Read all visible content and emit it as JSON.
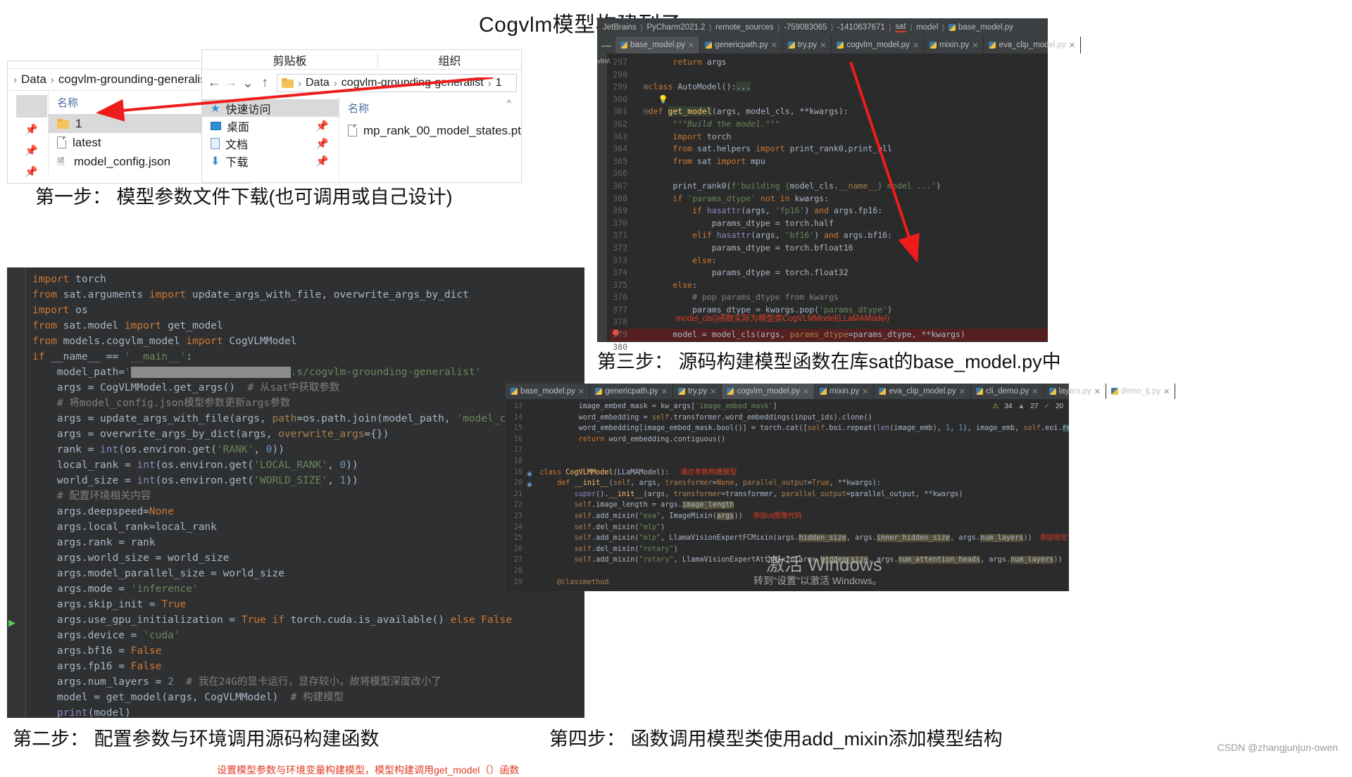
{
  "page": {
    "title": "Cogvlm模型构建列子",
    "credit": "CSDN @zhangjunjun-owen",
    "watermark_main": "激活 Windows",
    "watermark_sub": "转到\"设置\"以激活 Windows。"
  },
  "explorer_back": {
    "breadcrumb": [
      "Data",
      "cogvlm-grounding-generalist"
    ],
    "column_header": "名称",
    "items": [
      {
        "label": "1",
        "icon": "folder-icon",
        "selected": true
      },
      {
        "label": "latest",
        "icon": "file-icon",
        "selected": false
      },
      {
        "label": "model_config.json",
        "icon": "json-file-icon",
        "selected": false
      }
    ]
  },
  "explorer_front": {
    "ribbon_groups": [
      "剪贴板",
      "组织"
    ],
    "nav": {
      "back": "←",
      "forward": "→",
      "recent": "⌄",
      "up": "↑"
    },
    "breadcrumb": [
      "Data",
      "cogvlm-grounding-generalist",
      "1"
    ],
    "quick_access": {
      "title": "快速访问",
      "items": [
        {
          "label": "桌面",
          "icon": "desktop-icon",
          "pinned": true
        },
        {
          "label": "文档",
          "icon": "documents-icon",
          "pinned": true
        },
        {
          "label": "下载",
          "icon": "downloads-icon",
          "pinned": true
        }
      ]
    },
    "column_header": "名称",
    "files": [
      {
        "label": "mp_rank_00_model_states.pt",
        "icon": "file-icon"
      }
    ]
  },
  "steps": {
    "step1": "第一步： 模型参数文件下载(也可调用或自己设计)",
    "step2": "第二步： 配置参数与环境调用源码构建函数",
    "step3": "第三步： 源码构建模型函数在库sat的base_model.py中",
    "step4": "第四步： 函数调用模型类使用add_mixin添加模型结构"
  },
  "code_editor_step2": {
    "annotation": "设置模型参数与环境变量构建模型，模型构建调用get_model（）函数",
    "lines": [
      "import torch",
      "from sat.arguments import update_args_with_file, overwrite_args_by_dict",
      "import os",
      "from sat.model import get_model",
      "from models.cogvlm_model import import CogVLMModel",
      "if __name__ == '__main__':",
      "    model_path='/████/███/██████/██/██████.s/cogvlm-grounding-generalist'",
      "    args = CogVLMModel.get_args()  # 从sat中获取参数",
      "    # 将model_config.json模型参数更新args参数",
      "    args = update_args_with_file(args, path=os.path.join(model_path, 'model_config.json'))",
      "    args = overwrite_args_by_dict(args, overwrite_args={})",
      "    rank = int(os.environ.get('RANK', 0))",
      "    local_rank = int(os.environ.get('LOCAL_RANK', 0))",
      "    world_size = int(os.environ.get('WORLD_SIZE', 1))",
      "    # 配置环境相关内容",
      "    args.deepspeed=None",
      "    args.local_rank=local_rank",
      "    args.rank = rank",
      "    args.world_size = world_size",
      "    args.model_parallel_size = world_size",
      "    args.mode = 'inference'",
      "    args.skip_init = True",
      "    args.use_gpu_initialization = True if torch.cuda.is_available() else False",
      "    args.device = 'cuda'",
      "    args.bf16 = False",
      "    args.fp16 = False",
      "    args.num_layers = 2  # 我在24G的显卡运行，显存较小，故将模型深度改小了",
      "    model = get_model(args, CogVLMModel)  # 构建模型",
      "    print(model)"
    ]
  },
  "pycharm_step3": {
    "breadcrumb": [
      "JetBrains",
      "PyCharm2021.2",
      "remote_sources",
      "-759083065",
      "-1410637671",
      "sat",
      "model",
      "base_model.py"
    ],
    "tabs": [
      {
        "label": "base_model.py",
        "active": true
      },
      {
        "label": "genericpath.py",
        "active": false
      },
      {
        "label": "try.py",
        "active": false
      },
      {
        "label": "cogvlm_model.py",
        "active": false
      },
      {
        "label": "mixin.py",
        "active": false
      },
      {
        "label": "eva_clip_model.py",
        "active": false
      }
    ],
    "annotation": "model_cls()函数实际为模型类CogVLMModel(LLaMAModel)",
    "code": [
      {
        "n": "297",
        "text": "        return args"
      },
      {
        "n": "298",
        "text": ""
      },
      {
        "n": "299",
        "text": "    class AutoModel():..."
      },
      {
        "n": "300",
        "text": "        💡"
      },
      {
        "n": "361",
        "text": "    def get_model(args, model_cls, **kwargs):"
      },
      {
        "n": "362",
        "text": "        \"\"\"Build the model.\"\"\""
      },
      {
        "n": "363",
        "text": "        import torch"
      },
      {
        "n": "364",
        "text": "        from sat.helpers import print_rank0,print_all"
      },
      {
        "n": "365",
        "text": "        from sat import mpu"
      },
      {
        "n": "366",
        "text": ""
      },
      {
        "n": "367",
        "text": "        print_rank0(f'building {model_cls.__name__} model ...')"
      },
      {
        "n": "368",
        "text": "        if 'params_dtype' not in kwargs:"
      },
      {
        "n": "369",
        "text": "            if hasattr(args, 'fp16') and args.fp16:"
      },
      {
        "n": "370",
        "text": "                params_dtype = torch.half"
      },
      {
        "n": "371",
        "text": "            elif hasattr(args, 'bf16') and args.bf16:"
      },
      {
        "n": "372",
        "text": "                params_dtype = torch.bfloat16"
      },
      {
        "n": "373",
        "text": "            else:"
      },
      {
        "n": "374",
        "text": "                params_dtype = torch.float32"
      },
      {
        "n": "375",
        "text": "        else:"
      },
      {
        "n": "376",
        "text": "            # pop params_dtype from kwargs"
      },
      {
        "n": "377",
        "text": "            params_dtype = kwargs.pop('params_dtype')"
      },
      {
        "n": "378",
        "text": ""
      },
      {
        "n": "379",
        "text": "        model = model_cls(args, params_dtype=params_dtype, **kwargs)"
      },
      {
        "n": "380",
        "text": ""
      }
    ]
  },
  "pycharm_step4": {
    "tabs": [
      {
        "label": "base_model.py",
        "active": false
      },
      {
        "label": "genericpath.py",
        "active": false
      },
      {
        "label": "try.py",
        "active": false
      },
      {
        "label": "cogvlm_model.py",
        "active": true
      },
      {
        "label": "mixin.py",
        "active": false
      },
      {
        "label": "eva_clip_model.py",
        "active": false
      },
      {
        "label": "cli_demo.py",
        "active": false
      },
      {
        "label": "layers.py",
        "active": false
      },
      {
        "label": "demo_tj.py",
        "active": false
      }
    ],
    "inspection": {
      "warnings": "34",
      "weak": "27",
      "oks": "20"
    },
    "annotation_class": "通过参数构建模型",
    "annotation_mixin1": "添加vit图像代码",
    "annotation_mixin2": "添加视觉专家模块",
    "code": [
      {
        "n": "13",
        "text": "        image_embed_mask = kw_args['image_embed_mask']"
      },
      {
        "n": "14",
        "text": "        word_embedding = self.transformer.word_embeddings(input_ids).clone()"
      },
      {
        "n": "15",
        "text": "        word_embedding[image_embed_mask.bool()] = torch.cat([self.boi.repeat(len(image_emb), 1, 1), image_emb, self.eoi.repeat(len(image_em"
      },
      {
        "n": "16",
        "text": "        return word_embedding.contiguous()"
      },
      {
        "n": "17",
        "text": ""
      },
      {
        "n": "18",
        "text": ""
      },
      {
        "n": "19",
        "text": "    class CogVLMModel(LLaMAModel):"
      },
      {
        "n": "20",
        "text": "        def __init__(self, args, transformer=None, parallel_output=True, **kwargs):"
      },
      {
        "n": "21",
        "text": "            super().__init__(args, transformer=transformer, parallel_output=parallel_output, **kwargs)"
      },
      {
        "n": "22",
        "text": "            self.image_length = args.image_length"
      },
      {
        "n": "23",
        "text": "            self.add_mixin(\"eva\", ImageMixin(args))"
      },
      {
        "n": "24",
        "text": "            self.del_mixin(\"mlp\")"
      },
      {
        "n": "25",
        "text": "            self.add_mixin(\"mlp\", LlamaVisionExpertFCMixin(args.hidden_size, args.inner_hidden_size, args.num_layers))"
      },
      {
        "n": "26",
        "text": "            self.del_mixin(\"rotary\")"
      },
      {
        "n": "27",
        "text": "            self.add_mixin(\"rotary\", LlamaVisionExpertAttnMixin(args.hidden_size, args.num_attention_heads, args.num_layers))"
      },
      {
        "n": "28",
        "text": ""
      },
      {
        "n": "29",
        "text": "        @classmethod"
      }
    ]
  }
}
